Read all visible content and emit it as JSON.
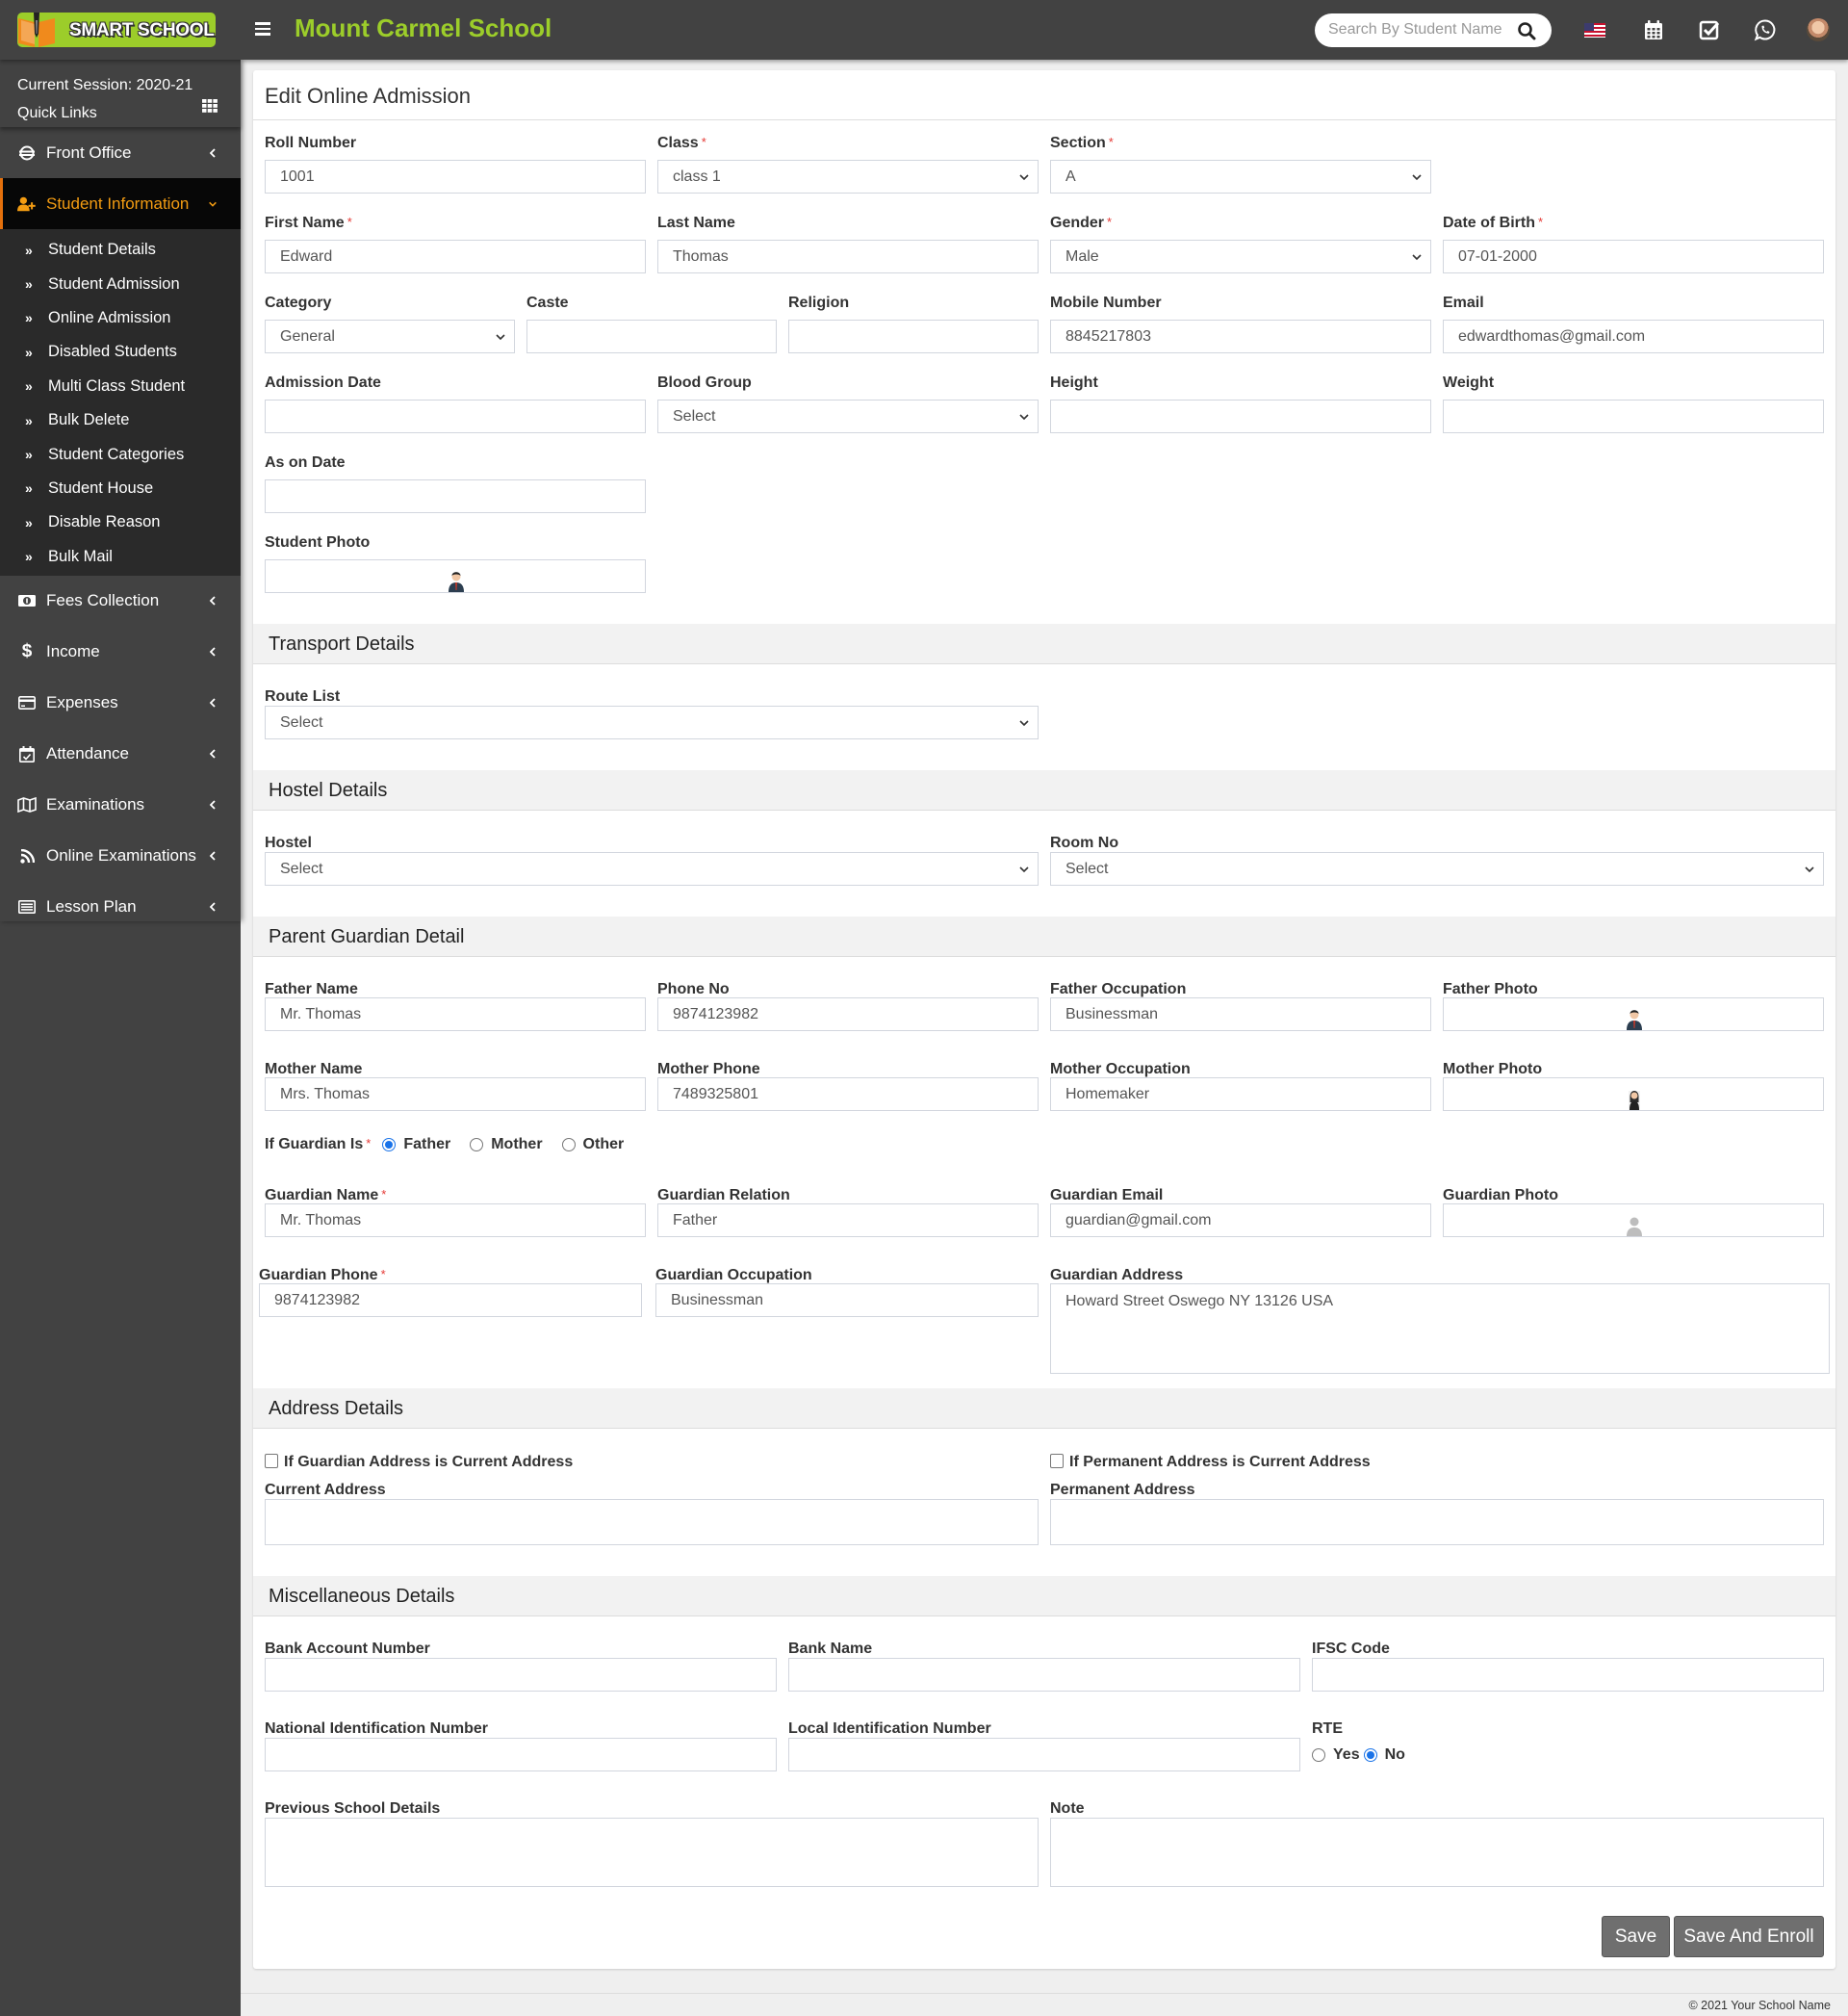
{
  "header": {
    "logo_text": "SMART SCHOOL",
    "school_name": "Mount Carmel School",
    "search_placeholder": "Search By Student Name",
    "icons": [
      "us-flag-icon",
      "calendar-icon",
      "task-check-icon",
      "whatsapp-icon",
      "user-avatar"
    ]
  },
  "sidebar": {
    "session": "Current Session: 2020-21",
    "quick_links": "Quick Links",
    "items": [
      {
        "label": "Front Office",
        "icon": "front-office-icon"
      },
      {
        "label": "Student Information",
        "icon": "user-plus-icon",
        "active": true,
        "subitems": [
          "Student Details",
          "Student Admission",
          "Online Admission",
          "Disabled Students",
          "Multi Class Student",
          "Bulk Delete",
          "Student Categories",
          "Student House",
          "Disable Reason",
          "Bulk Mail"
        ]
      },
      {
        "label": "Fees Collection",
        "icon": "money-icon"
      },
      {
        "label": "Income",
        "icon": "dollar-icon"
      },
      {
        "label": "Expenses",
        "icon": "credit-card-icon"
      },
      {
        "label": "Attendance",
        "icon": "calendar-check-icon"
      },
      {
        "label": "Examinations",
        "icon": "map-icon"
      },
      {
        "label": "Online Examinations",
        "icon": "rss-icon"
      },
      {
        "label": "Lesson Plan",
        "icon": "list-alt-icon"
      }
    ]
  },
  "page": {
    "title": "Edit Online Admission",
    "required_mark": "*"
  },
  "student": {
    "roll_number": {
      "label": "Roll Number",
      "value": "1001"
    },
    "class": {
      "label": "Class",
      "value": "class 1"
    },
    "section": {
      "label": "Section",
      "value": "A"
    },
    "first_name": {
      "label": "First Name",
      "value": "Edward"
    },
    "last_name": {
      "label": "Last Name",
      "value": "Thomas"
    },
    "gender": {
      "label": "Gender",
      "value": "Male"
    },
    "dob": {
      "label": "Date of Birth",
      "value": "07-01-2000"
    },
    "category": {
      "label": "Category",
      "value": "General"
    },
    "caste": {
      "label": "Caste",
      "value": ""
    },
    "religion": {
      "label": "Religion",
      "value": ""
    },
    "mobile": {
      "label": "Mobile Number",
      "value": "8845217803"
    },
    "email": {
      "label": "Email",
      "value": "edwardthomas@gmail.com"
    },
    "admission_date": {
      "label": "Admission Date",
      "value": ""
    },
    "blood_group": {
      "label": "Blood Group",
      "value": "Select"
    },
    "height": {
      "label": "Height",
      "value": ""
    },
    "weight": {
      "label": "Weight",
      "value": ""
    },
    "as_on_date": {
      "label": "As on Date",
      "value": ""
    },
    "photo": {
      "label": "Student Photo"
    }
  },
  "transport": {
    "heading": "Transport Details",
    "route_list": {
      "label": "Route List",
      "value": "Select"
    }
  },
  "hostel": {
    "heading": "Hostel Details",
    "hostel": {
      "label": "Hostel",
      "value": "Select"
    },
    "room_no": {
      "label": "Room No",
      "value": "Select"
    }
  },
  "parent": {
    "heading": "Parent Guardian Detail",
    "father_name": {
      "label": "Father Name",
      "value": "Mr. Thomas"
    },
    "father_phone": {
      "label": "Phone No",
      "value": "9874123982"
    },
    "father_occupation": {
      "label": "Father Occupation",
      "value": "Businessman"
    },
    "father_photo": {
      "label": "Father Photo"
    },
    "mother_name": {
      "label": "Mother Name",
      "value": "Mrs. Thomas"
    },
    "mother_phone": {
      "label": "Mother Phone",
      "value": "7489325801"
    },
    "mother_occupation": {
      "label": "Mother Occupation",
      "value": "Homemaker"
    },
    "mother_photo": {
      "label": "Mother Photo"
    },
    "guardian_is": {
      "label": "If Guardian Is",
      "options": [
        "Father",
        "Mother",
        "Other"
      ],
      "selected": "Father"
    },
    "guardian_name": {
      "label": "Guardian Name",
      "value": "Mr. Thomas"
    },
    "guardian_relation": {
      "label": "Guardian Relation",
      "value": "Father"
    },
    "guardian_email": {
      "label": "Guardian Email",
      "value": "guardian@gmail.com"
    },
    "guardian_photo": {
      "label": "Guardian Photo"
    },
    "guardian_phone": {
      "label": "Guardian Phone",
      "value": "9874123982"
    },
    "guardian_occupation": {
      "label": "Guardian Occupation",
      "value": "Businessman"
    },
    "guardian_address": {
      "label": "Guardian Address",
      "value": "Howard Street Oswego NY 13126 USA"
    }
  },
  "address": {
    "heading": "Address Details",
    "guardian_is_current": {
      "label": "If Guardian Address is Current Address",
      "checked": false
    },
    "permanent_is_current": {
      "label": "If Permanent Address is Current Address",
      "checked": false
    },
    "current_address": {
      "label": "Current Address",
      "value": ""
    },
    "permanent_address": {
      "label": "Permanent Address",
      "value": ""
    }
  },
  "misc": {
    "heading": "Miscellaneous Details",
    "bank_account": {
      "label": "Bank Account Number",
      "value": ""
    },
    "bank_name": {
      "label": "Bank Name",
      "value": ""
    },
    "ifsc": {
      "label": "IFSC Code",
      "value": ""
    },
    "nin": {
      "label": "National Identification Number",
      "value": ""
    },
    "lin": {
      "label": "Local Identification Number",
      "value": ""
    },
    "rte": {
      "label": "RTE",
      "options": [
        "Yes",
        "No"
      ],
      "selected": "No"
    },
    "previous_school": {
      "label": "Previous School Details",
      "value": ""
    },
    "note": {
      "label": "Note",
      "value": ""
    }
  },
  "actions": {
    "save": "Save",
    "save_enroll": "Save And Enroll"
  },
  "footer": {
    "copyright": "© 2021 Your School Name"
  },
  "colors": {
    "header_bg": "#424242",
    "brand_green": "#9ccd2a",
    "active_orange": "#f39c12",
    "button_gray": "#6f6f6f",
    "radio_blue": "#1a73e8"
  }
}
